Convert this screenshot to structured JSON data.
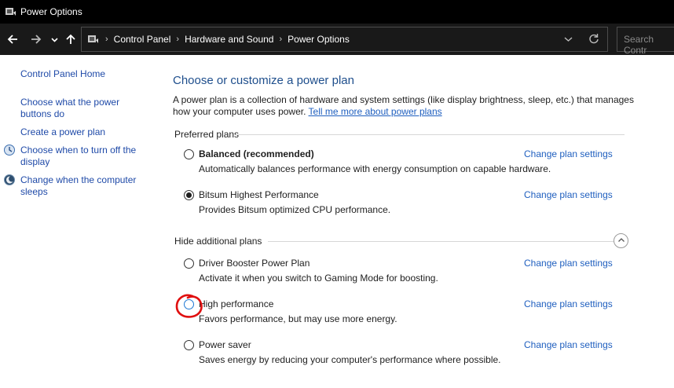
{
  "window": {
    "title": "Power Options",
    "icon": "power-options-icon"
  },
  "navigation": {
    "back_icon": "arrow-left-icon",
    "forward_icon": "arrow-right-icon",
    "recent_icon": "chevron-down-icon",
    "up_icon": "arrow-up-icon",
    "breadcrumb": [
      "Control Panel",
      "Hardware and Sound",
      "Power Options"
    ],
    "dropdown_icon": "chevron-down-icon",
    "refresh_icon": "refresh-icon",
    "search_placeholder": "Search Contr"
  },
  "sidebar": {
    "home_link": "Control Panel Home",
    "links": [
      {
        "label": "Choose what the power buttons do",
        "icon": null
      },
      {
        "label": "Create a power plan",
        "icon": null
      },
      {
        "label": "Choose when to turn off the display",
        "icon": "display-icon"
      },
      {
        "label": "Change when the computer sleeps",
        "icon": "moon-icon"
      }
    ]
  },
  "main": {
    "heading": "Choose or customize a power plan",
    "intro_text": "A power plan is a collection of hardware and system settings (like display brightness, sleep, etc.) that manages how your computer uses power.",
    "intro_link": "Tell me more about power plans",
    "preferred_label": "Preferred plans",
    "additional_label": "Hide additional plans",
    "change_link_label": "Change plan settings",
    "preferred_plans": [
      {
        "name": "Balanced (recommended)",
        "description": "Automatically balances performance with energy consumption on capable hardware.",
        "selected": false,
        "bold": true
      },
      {
        "name": "Bitsum Highest Performance",
        "description": "Provides Bitsum optimized CPU performance.",
        "selected": true,
        "bold": false
      }
    ],
    "additional_plans": [
      {
        "name": "Driver Booster Power Plan",
        "description": "Activate it when you switch to Gaming Mode for boosting.",
        "selected": false
      },
      {
        "name": "High performance",
        "description": "Favors performance, but may use more energy.",
        "selected": false
      },
      {
        "name": "Power saver",
        "description": "Saves energy by reducing your computer's performance where possible.",
        "selected": false
      }
    ]
  },
  "colors": {
    "link": "#1f5fbf",
    "heading": "#1e4e8c",
    "annotation": "#e01010",
    "titlebar": "#000000"
  }
}
